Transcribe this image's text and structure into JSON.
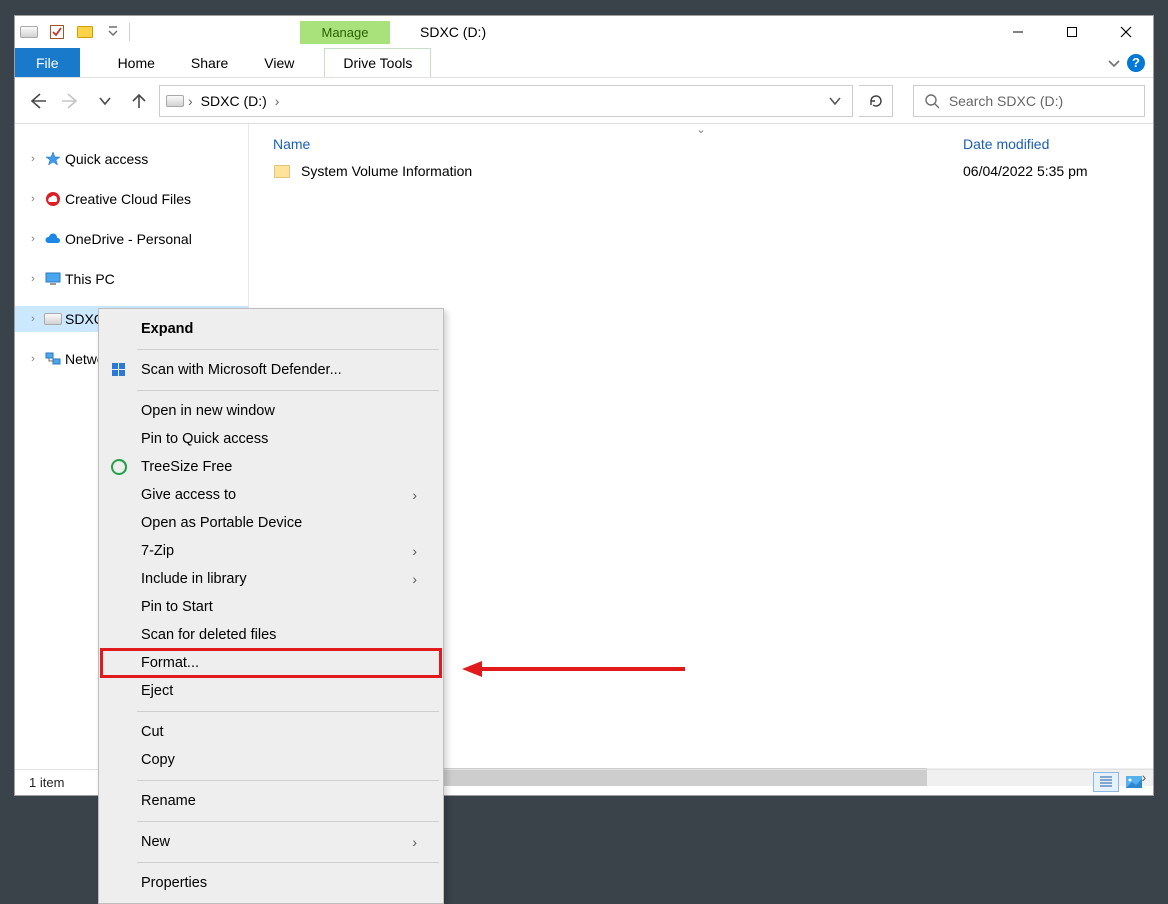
{
  "window": {
    "title": "SDXC (D:)",
    "manage_label": "Manage"
  },
  "ribbon": {
    "file": "File",
    "home": "Home",
    "share": "Share",
    "view": "View",
    "drive_tools": "Drive Tools"
  },
  "breadcrumb": {
    "segment": "SDXC (D:)"
  },
  "search": {
    "placeholder": "Search SDXC (D:)"
  },
  "sidebar": {
    "quick_access": "Quick access",
    "creative_cloud": "Creative Cloud Files",
    "onedrive": "OneDrive - Personal",
    "this_pc": "This PC",
    "sdxc": "SDXC (",
    "network": "Netwo"
  },
  "columns": {
    "name": "Name",
    "date": "Date modified"
  },
  "rows": [
    {
      "name": "System Volume Information",
      "date": "06/04/2022 5:35 pm"
    }
  ],
  "status": {
    "text": "1 item"
  },
  "context_menu": {
    "expand": "Expand",
    "defender": "Scan with Microsoft Defender...",
    "open_new": "Open in new window",
    "pin_qa": "Pin to Quick access",
    "treesize": "TreeSize Free",
    "give_access": "Give access to",
    "portable": "Open as Portable Device",
    "sevenzip": "7-Zip",
    "include_lib": "Include in library",
    "pin_start": "Pin to Start",
    "scan_deleted": "Scan for deleted files",
    "format": "Format...",
    "eject": "Eject",
    "cut": "Cut",
    "copy": "Copy",
    "rename": "Rename",
    "new": "New",
    "properties": "Properties"
  }
}
